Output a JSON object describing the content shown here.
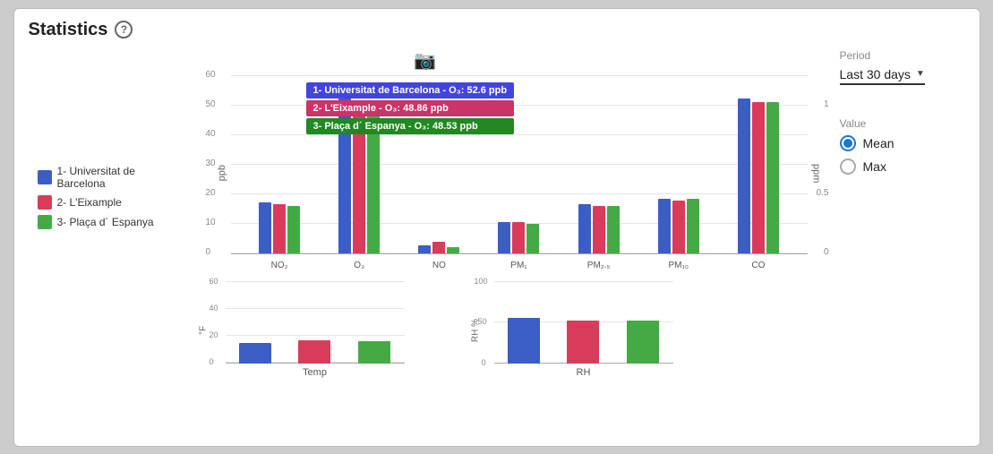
{
  "header": {
    "title": "Statistics",
    "help_label": "?"
  },
  "sidebar": {
    "period_label": "Period",
    "period_value": "Last 30 days",
    "value_label": "Value",
    "mean_label": "Mean",
    "max_label": "Max",
    "mean_selected": true
  },
  "legend": {
    "items": [
      {
        "label": "1- Universitat de Barcelona",
        "color": "#3b5ec6"
      },
      {
        "label": "2- L'Eixample",
        "color": "#d93c5b"
      },
      {
        "label": "3- Plaça d´ Espanya",
        "color": "#44ab44"
      }
    ]
  },
  "tooltip": {
    "items": [
      {
        "text": "1- Universitat de Barcelona - O₃: 52.6 ppb",
        "color": "#4444dd"
      },
      {
        "text": "2- L'Eixample - O₃: 48.86 ppb",
        "color": "#cc3366"
      },
      {
        "text": "3- Plaça d´ Espanya - O₃: 48.53 ppb",
        "color": "#228822"
      }
    ]
  },
  "main_chart": {
    "y_label": "ppb",
    "y_label_right": "ppm",
    "y_ticks": [
      "60",
      "50",
      "40",
      "30",
      "20",
      "10",
      "0"
    ],
    "y_ticks_right": [
      "1",
      "0.5",
      "0"
    ],
    "groups": [
      {
        "label": "NO₂",
        "bars": [
          {
            "color": "#3b5ec6",
            "height_pct": 29
          },
          {
            "color": "#d93c5b",
            "height_pct": 28
          },
          {
            "color": "#44ab44",
            "height_pct": 27
          }
        ]
      },
      {
        "label": "O₃",
        "bars": [
          {
            "color": "#3b5ec6",
            "height_pct": 88
          },
          {
            "color": "#d93c5b",
            "height_pct": 82
          },
          {
            "color": "#44ab44",
            "height_pct": 81
          }
        ]
      },
      {
        "label": "NO",
        "bars": [
          {
            "color": "#3b5ec6",
            "height_pct": 5
          },
          {
            "color": "#d93c5b",
            "height_pct": 7
          },
          {
            "color": "#44ab44",
            "height_pct": 4
          }
        ]
      },
      {
        "label": "PM₁",
        "bars": [
          {
            "color": "#3b5ec6",
            "height_pct": 18
          },
          {
            "color": "#d93c5b",
            "height_pct": 18
          },
          {
            "color": "#44ab44",
            "height_pct": 17
          }
        ]
      },
      {
        "label": "PM₂.₅",
        "bars": [
          {
            "color": "#3b5ec6",
            "height_pct": 28
          },
          {
            "color": "#d93c5b",
            "height_pct": 27
          },
          {
            "color": "#44ab44",
            "height_pct": 27
          }
        ]
      },
      {
        "label": "PM₁₀",
        "bars": [
          {
            "color": "#3b5ec6",
            "height_pct": 31
          },
          {
            "color": "#d93c5b",
            "height_pct": 30
          },
          {
            "color": "#44ab44",
            "height_pct": 31
          }
        ]
      },
      {
        "label": "CO",
        "bars": [
          {
            "color": "#3b5ec6",
            "height_pct": 87
          },
          {
            "color": "#d93c5b",
            "height_pct": 85
          },
          {
            "color": "#44ab44",
            "height_pct": 85
          }
        ]
      }
    ]
  },
  "temp_chart": {
    "label": "Temp",
    "y_label": "°F",
    "y_ticks": [
      "60",
      "40",
      "20",
      "0"
    ],
    "bars": [
      {
        "color": "#3b5ec6",
        "height_pct": 25
      },
      {
        "color": "#d93c5b",
        "height_pct": 28
      },
      {
        "color": "#44ab44",
        "height_pct": 27
      }
    ]
  },
  "rh_chart": {
    "label": "RH",
    "y_label": "RH %",
    "y_ticks": [
      "100",
      "50",
      "0"
    ],
    "bars": [
      {
        "color": "#3b5ec6",
        "height_pct": 55
      },
      {
        "color": "#d93c5b",
        "height_pct": 52
      },
      {
        "color": "#44ab44",
        "height_pct": 52
      }
    ]
  }
}
